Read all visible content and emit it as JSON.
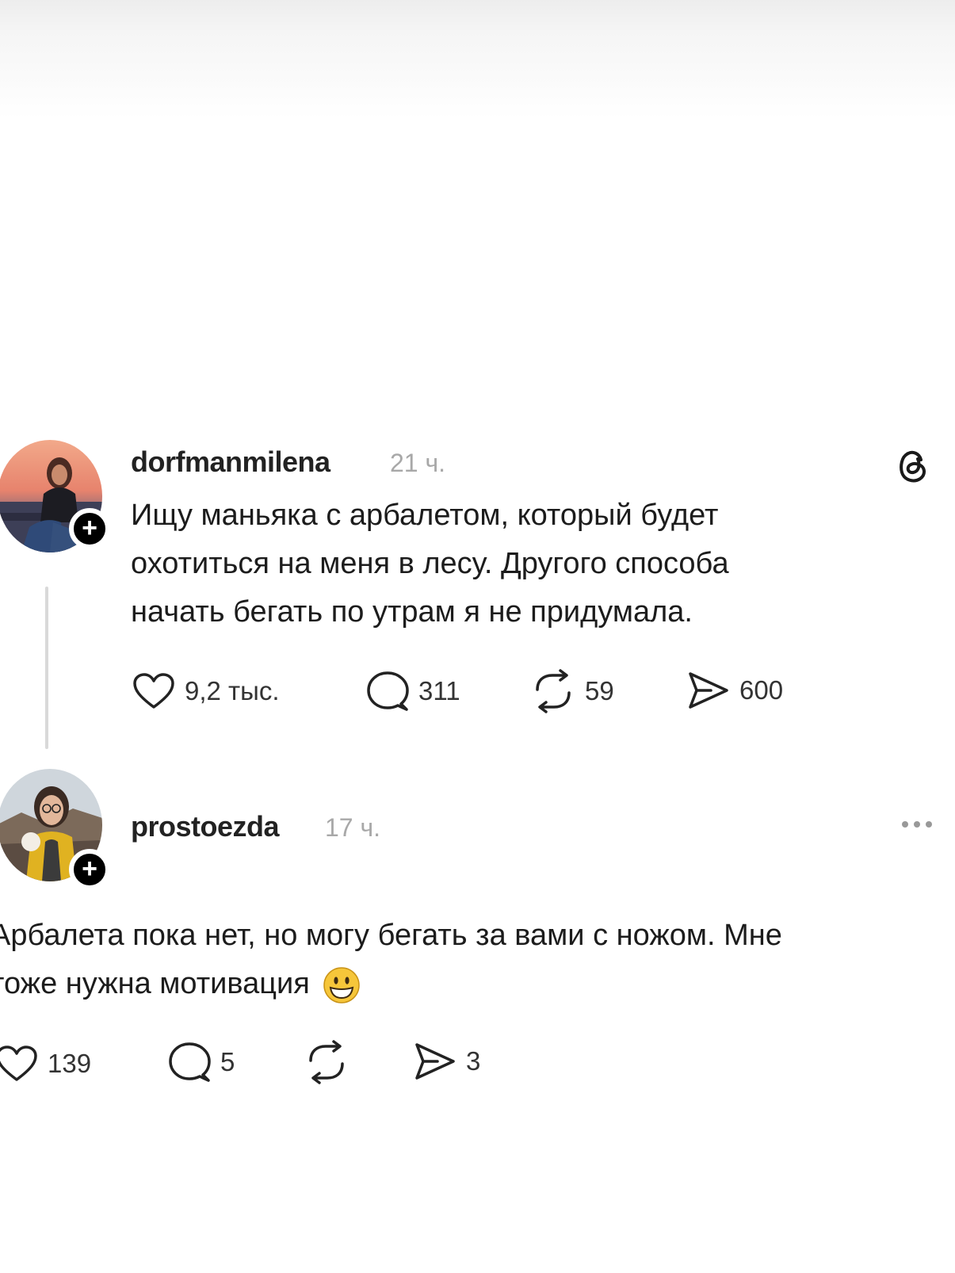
{
  "post1": {
    "username": "dorfmanmilena",
    "time": "21 ч.",
    "text_lines": [
      "Ищу маньяка с арбалетом, который будет",
      "охотиться на меня в лесу. Другого способа",
      "начать бегать по утрам я не придумала."
    ],
    "likes": "9,2 тыс.",
    "comments": "311",
    "reposts": "59",
    "shares": "600"
  },
  "post2": {
    "username": "prostoezda",
    "time": "17 ч.",
    "text_lines": [
      "Арбалета пока нет, но могу бегать за вами с ножом. Мне",
      "тоже нужна мотивация"
    ],
    "emoji": "grinning-face",
    "likes": "139",
    "comments": "5",
    "reposts": "",
    "shares": "3"
  },
  "icons": {
    "follow": "+",
    "threads": "threads-logo-icon",
    "more": "more-options-icon"
  },
  "colors": {
    "text": "#1c1c1c",
    "muted": "#a8a8a8",
    "icon": "#222222",
    "thread_line": "#d9d9d9"
  }
}
